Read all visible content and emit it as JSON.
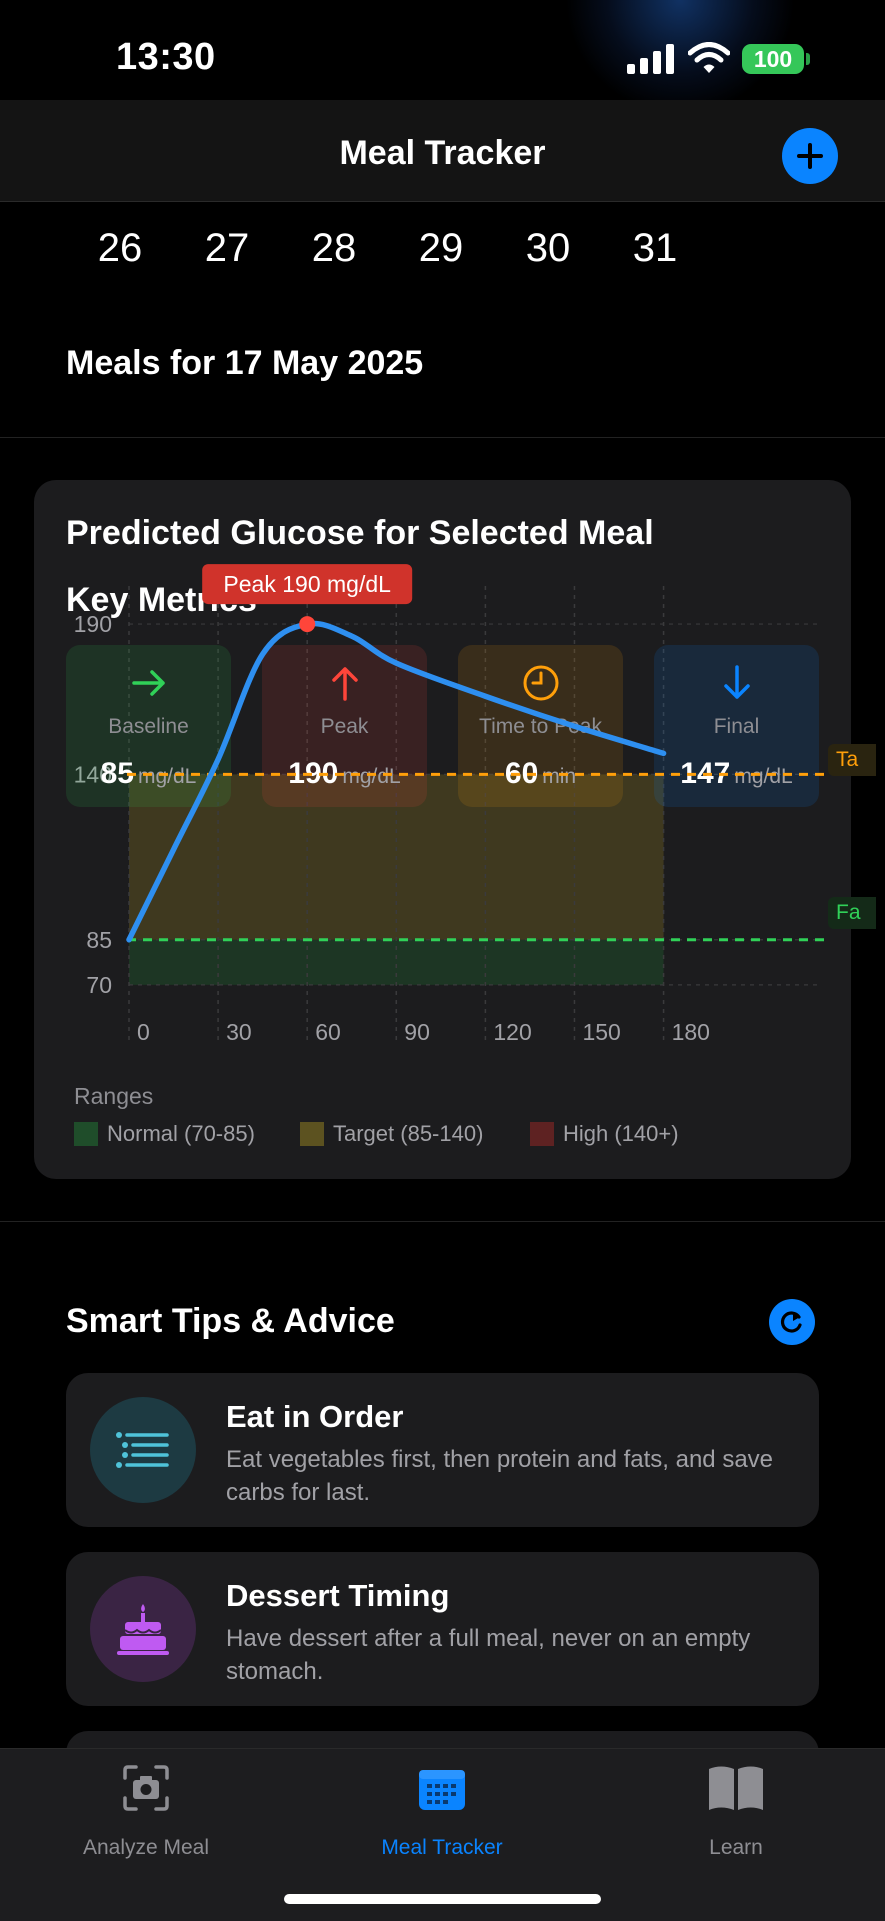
{
  "status_bar": {
    "time": "13:30",
    "battery": "100"
  },
  "nav": {
    "title": "Meal Tracker"
  },
  "dates": [
    "26",
    "27",
    "28",
    "29",
    "30",
    "31"
  ],
  "meals_heading": "Meals for 17 May 2025",
  "glucose_card": {
    "title": "Predicted Glucose for Selected Meal",
    "key_metrics_title": "Key Metrics",
    "metrics": [
      {
        "label": "Baseline",
        "value": "85",
        "unit": "mg/dL",
        "icon": "arrow-right-icon",
        "color": "#30d158"
      },
      {
        "label": "Peak",
        "value": "190",
        "unit": "mg/dL",
        "icon": "arrow-up-icon",
        "color": "#ff453a"
      },
      {
        "label": "Time to Peak",
        "value": "60",
        "unit": "min",
        "icon": "clock-icon",
        "color": "#ff9f0a"
      },
      {
        "label": "Final",
        "value": "147",
        "unit": "mg/dL",
        "icon": "arrow-down-icon",
        "color": "#0a84ff"
      }
    ],
    "peak_callout": "Peak 190 mg/dL",
    "target_line_label": "Ta",
    "fasting_line_label": "Fa",
    "ranges_label": "Ranges",
    "legend": [
      {
        "label": "Normal (70-85)",
        "color": "#1f4d2a"
      },
      {
        "label": "Target (85-140)",
        "color": "#5c5220"
      },
      {
        "label": "High (140+)",
        "color": "#5e2222"
      }
    ]
  },
  "chart_data": {
    "type": "line",
    "x": [
      0,
      15,
      30,
      45,
      60,
      75,
      90,
      120,
      150,
      180
    ],
    "series": [
      {
        "values": [
          85,
          115,
          145,
          180,
          190,
          186,
          177,
          166,
          156,
          147
        ]
      }
    ],
    "xticks": [
      "0",
      "30",
      "60",
      "90",
      "120",
      "150",
      "180"
    ],
    "yticks": [
      "70",
      "85",
      "140",
      "190"
    ],
    "xlim": [
      0,
      232
    ],
    "ylim": [
      50,
      200
    ],
    "reference_lines": [
      {
        "y": 140,
        "color": "#ff9f0a",
        "style": "dashed"
      },
      {
        "y": 85,
        "color": "#30d158",
        "style": "dashed"
      }
    ],
    "bands": [
      {
        "from": 70,
        "to": 85,
        "color": "#1f4d2a"
      },
      {
        "from": 85,
        "to": 140,
        "color": "#5c5220"
      },
      {
        "from": 140,
        "to": 200,
        "color": "#5e2222"
      }
    ],
    "peak": {
      "x": 60,
      "y": 190
    },
    "grid": true
  },
  "tips": {
    "heading": "Smart Tips & Advice",
    "items": [
      {
        "title": "Eat in Order",
        "body": "Eat vegetables first, then protein and fats, and save carbs for last.",
        "icon": "list-order-icon",
        "color": "#4fc3d9"
      },
      {
        "title": "Dessert Timing",
        "body": "Have dessert after a full meal, never on an empty stomach.",
        "icon": "cake-icon",
        "color": "#bf5af2"
      }
    ]
  },
  "tabbar": {
    "tabs": [
      {
        "label": "Analyze Meal",
        "icon": "camera-icon",
        "active": false
      },
      {
        "label": "Meal Tracker",
        "icon": "calendar-icon",
        "active": true
      },
      {
        "label": "Learn",
        "icon": "book-icon",
        "active": false
      }
    ],
    "active_color": "#0a84ff"
  }
}
